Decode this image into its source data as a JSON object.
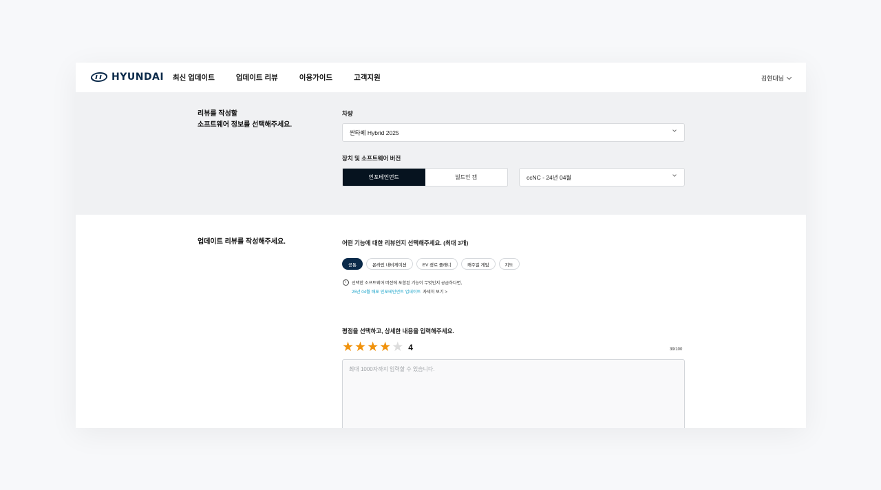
{
  "header": {
    "logo_text": "HYUNDAI",
    "nav": [
      "최신 업데이트",
      "업데이트 리뷰",
      "이용가이드",
      "고객지원"
    ],
    "user_name": "김현대님"
  },
  "selection": {
    "title_line1": "리뷰를 작성할",
    "title_line2": "소프트웨어 정보를 선택해주세요.",
    "vehicle_label": "차량",
    "vehicle_value": "싼타페 Hybrid 2025",
    "device_label": "장치 및 소프트웨어 버전",
    "device_options": [
      {
        "label": "인포테인먼트",
        "active": true
      },
      {
        "label": "빌트인 캠",
        "active": false
      }
    ],
    "version_value": "ccNC - 24년 04월"
  },
  "review": {
    "title": "업데이트 리뷰를 작성해주세요.",
    "feature_question": "어떤 기능에 대한 리뷰인지 선택해주세요. (최대 3개)",
    "features": [
      {
        "label": "공통",
        "active": true
      },
      {
        "label": "온라인 내비게이션",
        "active": false
      },
      {
        "label": "EV 경로 플래너",
        "active": false
      },
      {
        "label": "캐주얼 게임",
        "active": false
      },
      {
        "label": "지도",
        "active": false
      }
    ],
    "info_icon": "i",
    "info_text": "선택한 소프트웨어 버전에 포함된 기능이 무엇인지 궁금하다면,",
    "info_link": "25년 04월 배포 인포테인먼트 업데이트",
    "info_more": "자세히 보기 >",
    "rating_question": "평점을 선택하고, 상세한 내용을 입력해주세요.",
    "rating": 4,
    "rating_max": 5,
    "rating_label": "4",
    "counter": "39/100",
    "placeholder": "최대 1000자까지 입력할 수 있습니다."
  },
  "colors": {
    "brand": "#0b2a4a",
    "star": "#f0920c",
    "link": "#19a3c9",
    "toggle_active": "#06131f"
  }
}
